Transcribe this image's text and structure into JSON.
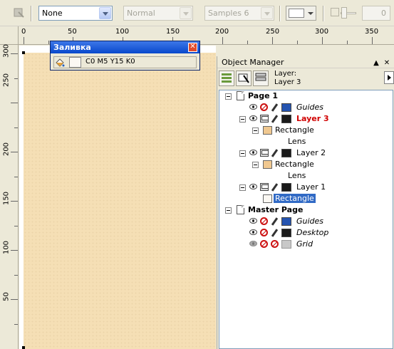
{
  "toolbar": {
    "outline_select": "None",
    "mode_select": "Normal",
    "samples_select": "Samples 6",
    "fill_color": "#ffffff",
    "number_value": "0"
  },
  "rulers": {
    "horizontal": [
      "0",
      "50",
      "100",
      "150",
      "200",
      "250",
      "300",
      "350"
    ],
    "vertical": [
      "300",
      "250",
      "200",
      "150",
      "100",
      "50"
    ]
  },
  "fill_window": {
    "title": "Заливка",
    "close_label": "✕",
    "swatch_color": "#fbf8f3",
    "color_text": "C0 M5 Y15 K0"
  },
  "object_manager": {
    "title": "Object Manager",
    "layer_label": "Layer:",
    "layer_name": "Layer 3",
    "tree": {
      "page1": "Page 1",
      "guides1": "Guides",
      "layer3": "Layer 3",
      "rect3": "Rectangle",
      "lens3": "Lens",
      "layer2": "Layer 2",
      "rect2": "Rectangle",
      "lens2": "Lens",
      "layer1": "Layer 1",
      "rect1": "Rectangle",
      "master": "Master Page",
      "guides_m": "Guides",
      "desktop": "Desktop",
      "grid": "Grid"
    }
  },
  "colors": {
    "page_fill": "#f5dfb5",
    "guides_swatch": "#2554b0",
    "layer_swatch": "#1a1a1a",
    "rect_swatch": "#f0c890",
    "grid_swatch": "#c8c8c8",
    "selection": "#316ac5"
  }
}
